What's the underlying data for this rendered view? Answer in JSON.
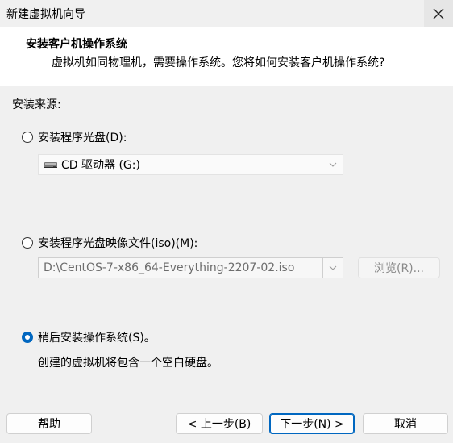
{
  "window": {
    "title": "新建虚拟机向导"
  },
  "header": {
    "title": "安装客户机操作系统",
    "subtitle": "虚拟机如同物理机，需要操作系统。您将如何安装客户机操作系统?"
  },
  "install_source": {
    "label": "安装来源:",
    "disc_option": {
      "label": "安装程序光盘(D):",
      "selected": false
    },
    "disc_drive": {
      "value": "CD 驱动器 (G:)",
      "icon": "cd-drive-icon"
    },
    "iso_option": {
      "label": "安装程序光盘映像文件(iso)(M):",
      "selected": false
    },
    "iso_path": {
      "value": "D:\\CentOS-7-x86_64-Everything-2207-02.iso"
    },
    "browse_label": "浏览(R)...",
    "later_option": {
      "label": "稍后安装操作系统(S)。",
      "selected": true
    },
    "later_note": "创建的虚拟机将包含一个空白硬盘。"
  },
  "footer": {
    "help": "帮助",
    "back": "< 上一步(B)",
    "next": "下一步(N) >",
    "cancel": "取消"
  },
  "colors": {
    "accent": "#0067c0",
    "background": "#f0f0f0",
    "header": "#ffffff"
  }
}
